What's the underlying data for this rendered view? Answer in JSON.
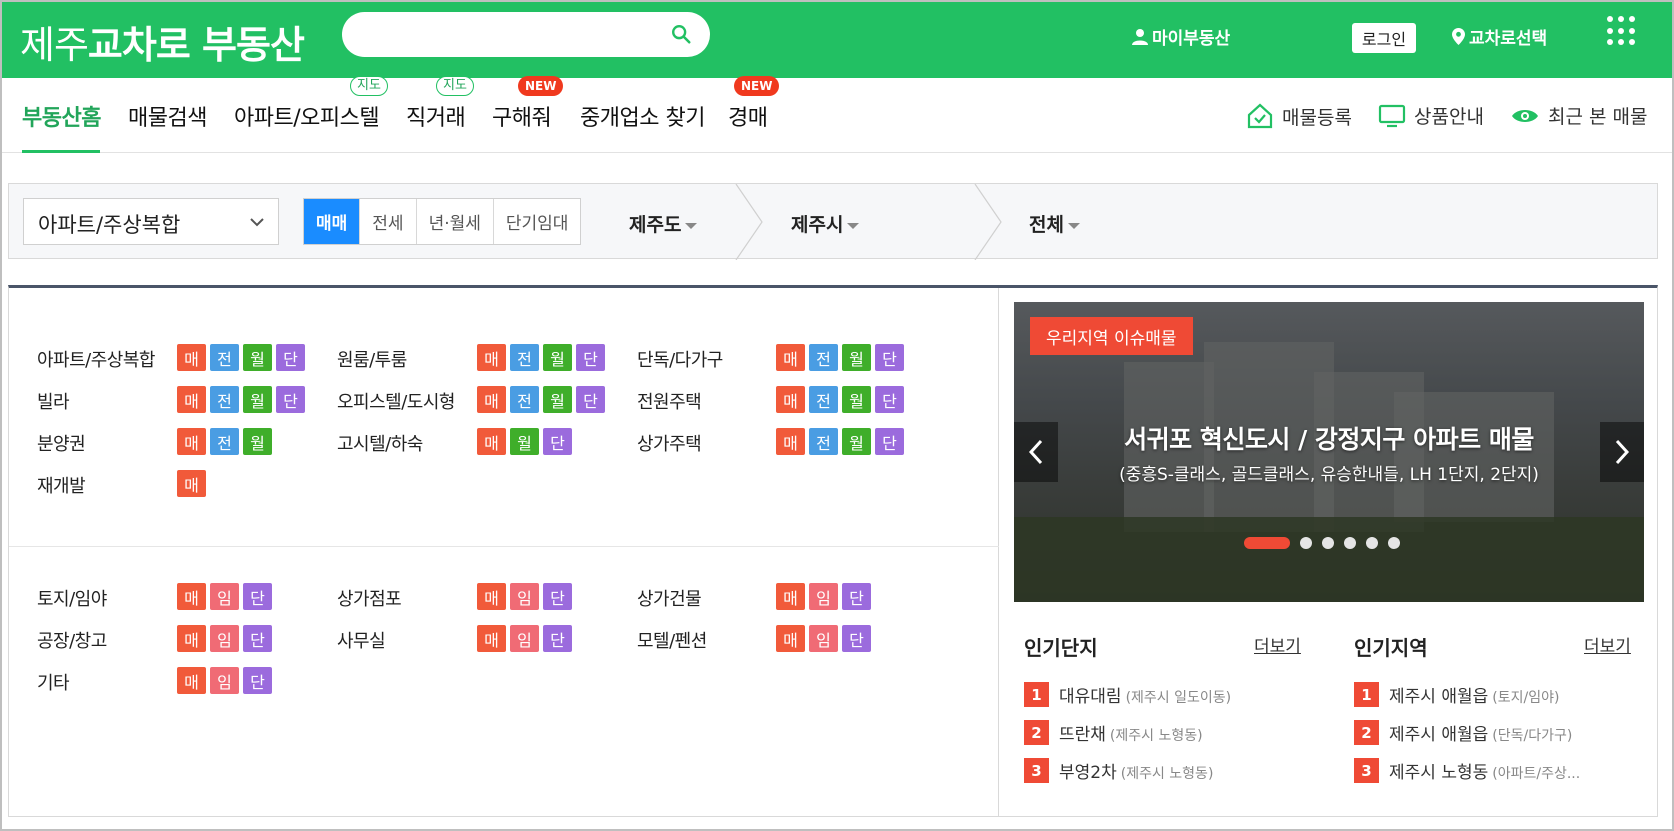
{
  "header": {
    "logo_light": "제주",
    "logo_bold": "교차로 부동산",
    "search_placeholder": "",
    "my_realestate": "마이부동산",
    "login": "로그인",
    "region_select": "교차로선택"
  },
  "nav": {
    "tabs": [
      {
        "label": "부동산홈"
      },
      {
        "label": "매물검색"
      },
      {
        "label": "아파트/오피스텔",
        "badge": "지도"
      },
      {
        "label": "직거래",
        "badge": "지도"
      },
      {
        "label": "구해줘",
        "badge": "NEW"
      },
      {
        "label": "중개업소 찾기"
      },
      {
        "label": "경매",
        "badge": "NEW"
      }
    ],
    "right": [
      "매물등록",
      "상품안내",
      "최근 본 매물"
    ]
  },
  "filter": {
    "type": "아파트/주상복합",
    "deals": [
      "매매",
      "전세",
      "년·월세",
      "단기임대"
    ],
    "regions": [
      "제주도",
      "제주시",
      "전체"
    ]
  },
  "categories_top": [
    {
      "name": "아파트/주상복합",
      "tags": [
        "매",
        "전",
        "월",
        "단"
      ]
    },
    {
      "name": "원룸/투룸",
      "tags": [
        "매",
        "전",
        "월",
        "단"
      ]
    },
    {
      "name": "단독/다가구",
      "tags": [
        "매",
        "전",
        "월",
        "단"
      ]
    },
    {
      "name": "빌라",
      "tags": [
        "매",
        "전",
        "월",
        "단"
      ]
    },
    {
      "name": "오피스텔/도시형",
      "tags": [
        "매",
        "전",
        "월",
        "단"
      ]
    },
    {
      "name": "전원주택",
      "tags": [
        "매",
        "전",
        "월",
        "단"
      ]
    },
    {
      "name": "분양권",
      "tags": [
        "매",
        "전",
        "월"
      ]
    },
    {
      "name": "고시텔/하숙",
      "tags": [
        "매",
        "월",
        "단"
      ]
    },
    {
      "name": "상가주택",
      "tags": [
        "매",
        "전",
        "월",
        "단"
      ]
    },
    {
      "name": "재개발",
      "tags": [
        "매"
      ]
    }
  ],
  "categories_bottom": [
    {
      "name": "토지/임야",
      "tags": [
        "매",
        "임",
        "단"
      ]
    },
    {
      "name": "상가점포",
      "tags": [
        "매",
        "임",
        "단"
      ]
    },
    {
      "name": "상가건물",
      "tags": [
        "매",
        "임",
        "단"
      ]
    },
    {
      "name": "공장/창고",
      "tags": [
        "매",
        "임",
        "단"
      ]
    },
    {
      "name": "사무실",
      "tags": [
        "매",
        "임",
        "단"
      ]
    },
    {
      "name": "모텔/펜션",
      "tags": [
        "매",
        "임",
        "단"
      ]
    },
    {
      "name": "기타",
      "tags": [
        "매",
        "임",
        "단"
      ]
    }
  ],
  "banner": {
    "badge": "우리지역 이슈매물",
    "title": "서귀포 혁신도시 / 강정지구 아파트 매물",
    "subtitle": "(중흥S-클래스, 골드클래스, 유승한내들, LH 1단지, 2단지)",
    "dot_count": 6,
    "active_dot": 0
  },
  "popular_complex": {
    "title": "인기단지",
    "more": "더보기",
    "items": [
      {
        "rank": "1",
        "name": "대유대림",
        "sub": "(제주시 일도이동)"
      },
      {
        "rank": "2",
        "name": "뜨란채",
        "sub": "(제주시 노형동)"
      },
      {
        "rank": "3",
        "name": "부영2차",
        "sub": "(제주시 노형동)"
      }
    ]
  },
  "popular_region": {
    "title": "인기지역",
    "more": "더보기",
    "items": [
      {
        "rank": "1",
        "name": "제주시 애월읍",
        "sub": "(토지/임야)"
      },
      {
        "rank": "2",
        "name": "제주시 애월읍",
        "sub": "(단독/다가구)"
      },
      {
        "rank": "3",
        "name": "제주시 노형동",
        "sub": "(아파트/주상..."
      }
    ]
  },
  "colors": {
    "brand": "#22c063",
    "deal_active": "#1a8cff",
    "accent_red": "#ef4a35"
  }
}
